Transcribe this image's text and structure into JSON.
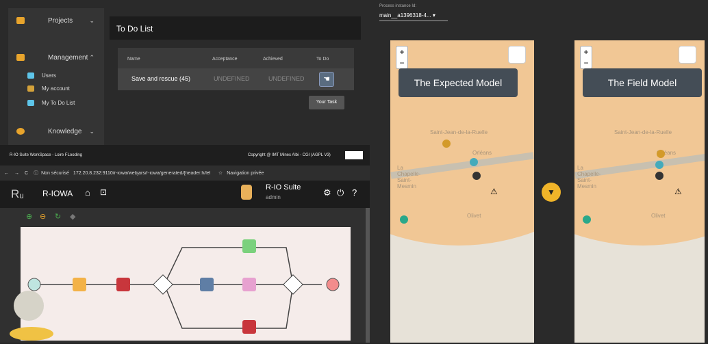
{
  "sidebar": {
    "projects": "Projects",
    "management": "Management",
    "users": "Users",
    "my_account": "My account",
    "my_todo": "My To Do List",
    "knowledge": "Knowledge"
  },
  "todo": {
    "title": "To Do List",
    "headers": [
      "Name",
      "Acceptance",
      "Achieved",
      "To Do"
    ],
    "row": {
      "name": "Save and rescue (45)",
      "acceptance": "UNDEFINED",
      "achieved": "UNDEFINED"
    },
    "tooltip": "Your Task"
  },
  "footer": {
    "left": "R-IO Suite WorkSpace - Loire FLooding",
    "right": "Copyright @ IMT Mines Albi - CGI (AGPL V3)"
  },
  "browser": {
    "security": "Non sécurisé",
    "url": "172.20.8.232:9110/r-iowa/webjars/r-iowa/generated/{header:h/leftP...",
    "private": "Navigation privée"
  },
  "app": {
    "name": "R-IOWA",
    "suite": "R-IO Suite",
    "user": "admin"
  },
  "process": {
    "label": "Process instance Id:",
    "value": "main__a1396318-4..."
  },
  "maps": [
    {
      "title": "The Expected Model"
    },
    {
      "title": "The Field Model"
    }
  ],
  "map_labels": {
    "town1": "Saint-Jean-de-la-Ruelle",
    "town2": "La Chapelle-Saint-Mesmin",
    "town3": "Olivet",
    "town4": "Orléans"
  }
}
